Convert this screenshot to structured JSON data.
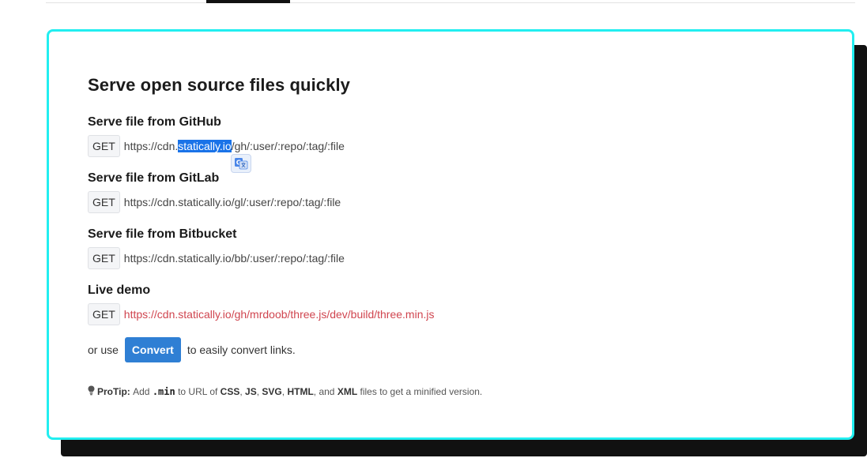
{
  "card": {
    "title": "Serve open source files quickly",
    "sections": [
      {
        "heading": "Serve file from GitHub",
        "method": "GET",
        "url_pre": "https://cdn.",
        "url_highlight": "statically.io",
        "url_post": "/gh/:user/:repo/:tag/:file"
      },
      {
        "heading": "Serve file from GitLab",
        "method": "GET",
        "url": "https://cdn.statically.io/gl/:user/:repo/:tag/:file"
      },
      {
        "heading": "Serve file from Bitbucket",
        "method": "GET",
        "url": "https://cdn.statically.io/bb/:user/:repo/:tag/:file"
      },
      {
        "heading": "Live demo",
        "method": "GET",
        "url": "https://cdn.statically.io/gh/mrdoob/three.js/dev/build/three.min.js"
      }
    ],
    "convert": {
      "prefix": "or use",
      "button": "Convert",
      "suffix": "to easily convert links."
    },
    "protip": {
      "label": "ProTip:",
      "t1": "Add",
      "code": ".min",
      "t2": "to URL of",
      "f1": "CSS",
      "sep1": ",",
      "f2": "JS",
      "sep2": ",",
      "f3": "SVG",
      "sep3": ",",
      "f4": "HTML",
      "t3": ", and",
      "f5": "XML",
      "t4": "files to get a minified version."
    }
  },
  "colors": {
    "card_border": "#22eef0",
    "link": "#d0454f",
    "button": "#2f7fd4",
    "selection": "#1a73e8"
  },
  "icons": {
    "translate": "google-translate-icon",
    "protip": "lightbulb-icon"
  }
}
